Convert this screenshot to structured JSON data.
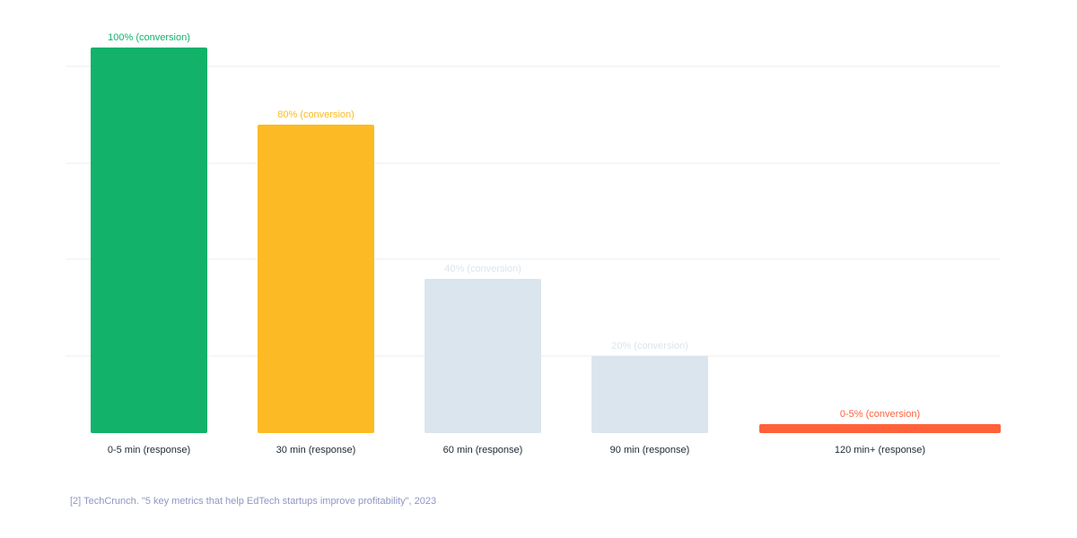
{
  "chart_data": {
    "type": "bar",
    "categories": [
      "0-5 min (response)",
      "30 min (response)",
      "60 min (response)",
      "90 min (response)",
      "120 min+ (response)"
    ],
    "values": [
      100,
      80,
      40,
      20,
      2.5
    ],
    "data_labels": [
      "100% (conversion)",
      "80% (conversion)",
      "40% (conversion)",
      "20% (conversion)",
      "0-5% (conversion)"
    ],
    "bar_colors": [
      "#12b26b",
      "#fcbb24",
      "#dbe5ee",
      "#dbe5ee",
      "#ff623a"
    ],
    "label_colors": [
      "#12b26b",
      "#fcbb24",
      "#dbe5ee",
      "#dbe5ee",
      "#ff623a"
    ],
    "gridline_values": [
      25,
      50,
      75,
      100
    ],
    "grid_color": "#e9edf2",
    "ylim": [
      0,
      100
    ],
    "grid": true,
    "title": "",
    "xlabel": "",
    "ylabel": ""
  },
  "source": "[2] TechCrunch. \"5 key metrics that help EdTech startups improve profitability\", 2023"
}
